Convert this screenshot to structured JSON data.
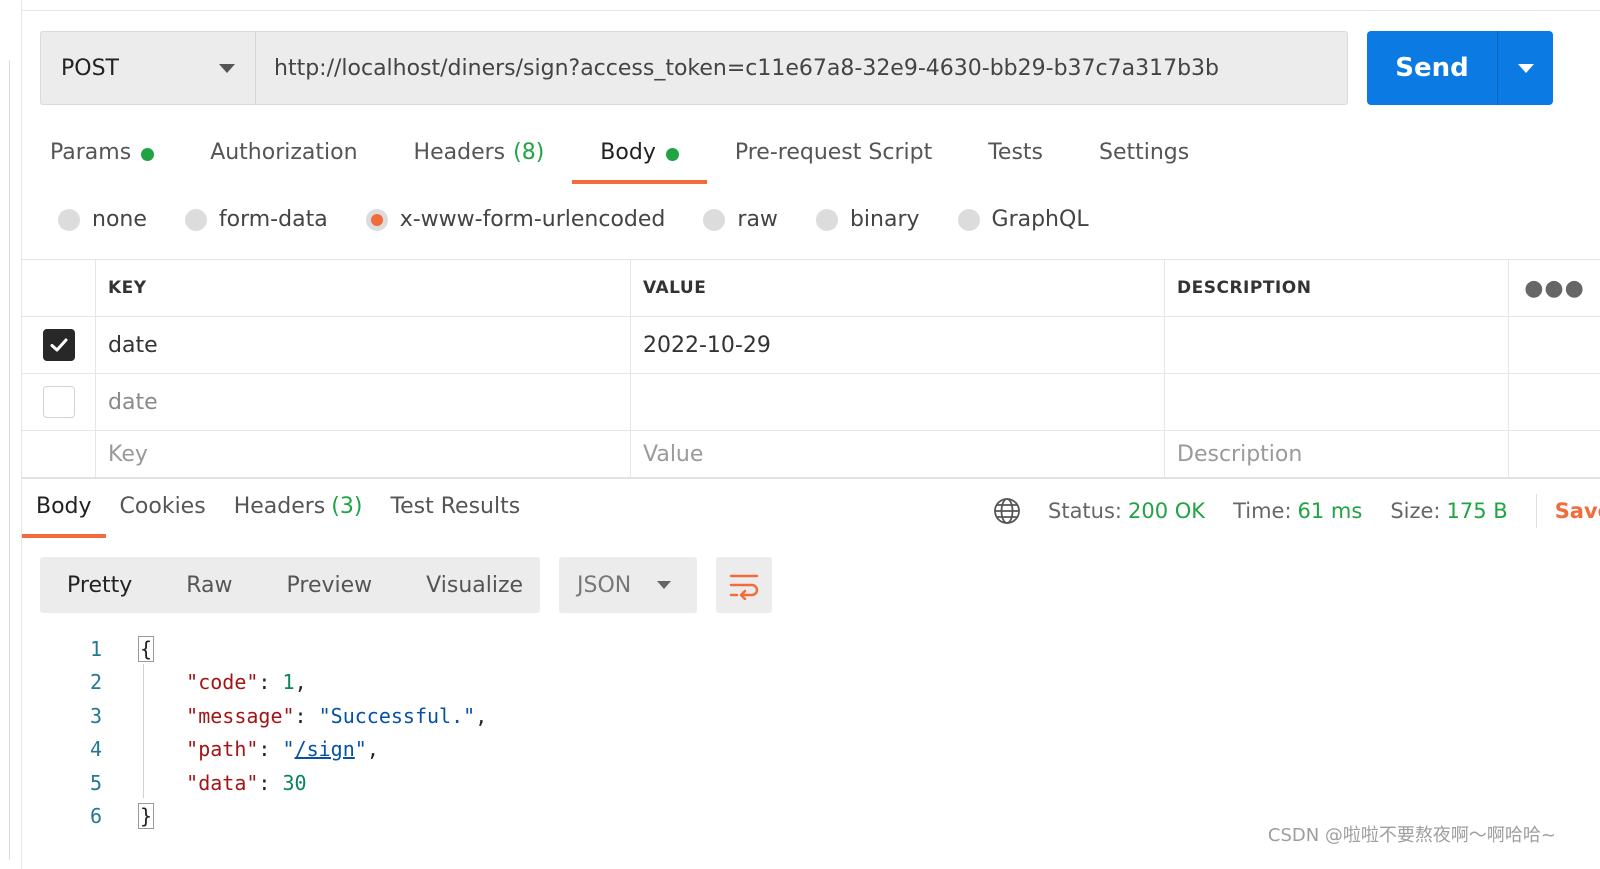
{
  "request": {
    "method": "POST",
    "url": "http://localhost/diners/sign?access_token=c11e67a8-32e9-4630-bb29-b37c7a317b3b",
    "send_label": "Send"
  },
  "req_tabs": [
    {
      "label": "Params",
      "dot": true
    },
    {
      "label": "Authorization"
    },
    {
      "label": "Headers",
      "count": "(8)"
    },
    {
      "label": "Body",
      "dot": true,
      "active": true
    },
    {
      "label": "Pre-request Script"
    },
    {
      "label": "Tests"
    },
    {
      "label": "Settings"
    }
  ],
  "body_types": [
    {
      "label": "none"
    },
    {
      "label": "form-data"
    },
    {
      "label": "x-www-form-urlencoded",
      "checked": true
    },
    {
      "label": "raw"
    },
    {
      "label": "binary"
    },
    {
      "label": "GraphQL"
    }
  ],
  "table": {
    "headers": {
      "key": "KEY",
      "value": "VALUE",
      "description": "DESCRIPTION"
    },
    "rows": [
      {
        "checked": true,
        "key": "date",
        "value": "2022-10-29",
        "description": ""
      },
      {
        "checked": false,
        "key": "date",
        "value": "",
        "description": ""
      }
    ],
    "placeholders": {
      "key": "Key",
      "value": "Value",
      "description": "Description"
    }
  },
  "response": {
    "tabs": [
      {
        "label": "Body",
        "active": true
      },
      {
        "label": "Cookies"
      },
      {
        "label": "Headers",
        "count": "(3)"
      },
      {
        "label": "Test Results"
      }
    ],
    "status_label": "Status:",
    "status_value": "200 OK",
    "time_label": "Time:",
    "time_value": "61 ms",
    "size_label": "Size:",
    "size_value": "175 B",
    "save_label": "Save",
    "formats": [
      "Pretty",
      "Raw",
      "Preview",
      "Visualize"
    ],
    "language": "JSON",
    "code_lines": [
      "1",
      "2",
      "3",
      "4",
      "5",
      "6"
    ],
    "json": {
      "code_key": "\"code\"",
      "code_val": "1",
      "message_key": "\"message\"",
      "message_val": "\"Successful.\"",
      "path_key": "\"path\"",
      "path_val": "/sign",
      "data_key": "\"data\"",
      "data_val": "30"
    }
  },
  "watermark": "CSDN @啦啦不要熬夜啊～啊哈哈~",
  "colors": {
    "accent": "#f26b3a",
    "send_button": "#0b7be3",
    "status_green": "#1fa343"
  }
}
